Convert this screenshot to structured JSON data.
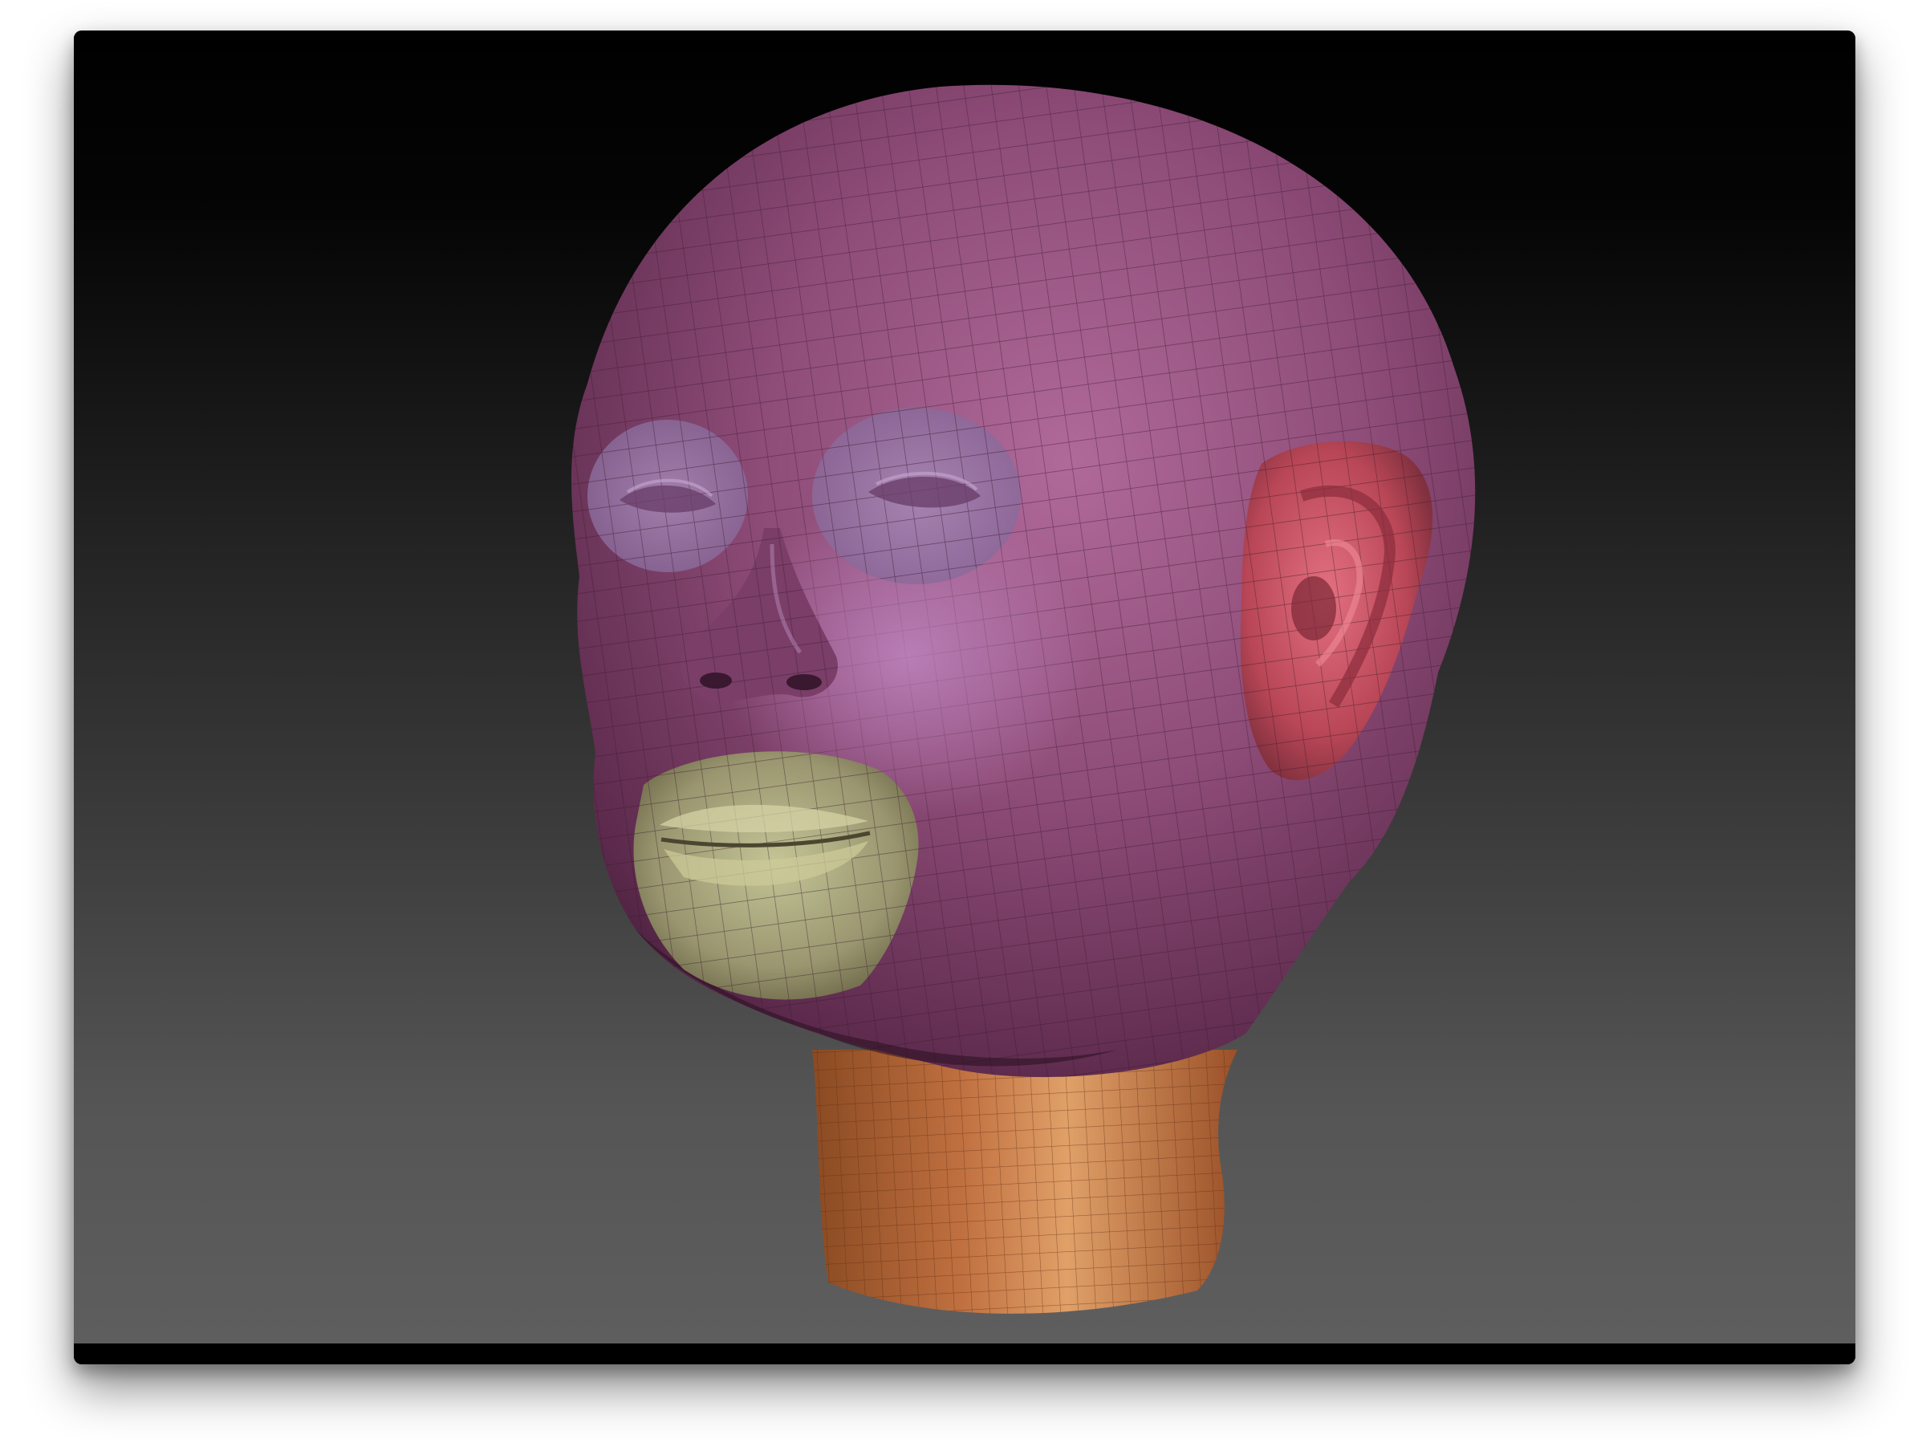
{
  "viewport": {
    "subject": "sculpted-head-model",
    "background_colors": [
      "#000000",
      "#5e5e5e"
    ]
  },
  "model": {
    "regions": [
      {
        "name": "head",
        "color": "#8a4a72"
      },
      {
        "name": "eye-sockets",
        "color": "#9a7aa6"
      },
      {
        "name": "ear",
        "color": "#c04a5a"
      },
      {
        "name": "mouth",
        "color": "#9e9a70"
      },
      {
        "name": "neck",
        "color": "#c07040"
      }
    ],
    "wireframe_color": "#3a1a2a"
  }
}
